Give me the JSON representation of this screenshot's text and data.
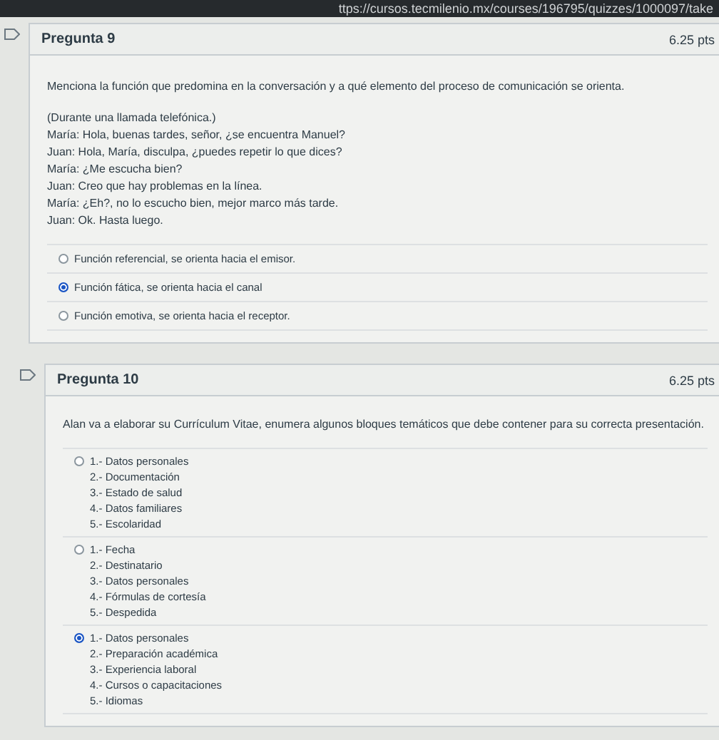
{
  "address_bar": {
    "url": "ttps://cursos.tecmilenio.mx/courses/196795/quizzes/1000097/take"
  },
  "questions": [
    {
      "title": "Pregunta 9",
      "points": "6.25 pts",
      "prompt": [
        "Menciona la función que predomina en la conversación y a qué elemento del proceso de comunicación se orienta.",
        "(Durante una llamada telefónica.)",
        "María: Hola, buenas tardes, señor, ¿se encuentra Manuel?",
        "Juan: Hola, María, disculpa, ¿puedes repetir lo que dices?",
        "María: ¿Me escucha bien?",
        "Juan: Creo que hay problemas en la línea.",
        "María: ¿Eh?, no lo escucho bien, mejor marco más tarde.",
        "Juan: Ok. Hasta luego."
      ],
      "answers": [
        {
          "lines": [
            "Función referencial, se orienta hacia el emisor."
          ],
          "selected": false
        },
        {
          "lines": [
            "Función fática, se orienta hacia el canal"
          ],
          "selected": true
        },
        {
          "lines": [
            "Función emotiva, se orienta hacia el receptor."
          ],
          "selected": false
        }
      ]
    },
    {
      "title": "Pregunta 10",
      "points": "6.25 pts",
      "prompt": [
        "Alan va a elaborar su Currículum Vitae, enumera algunos bloques temáticos que debe contener para su correcta presentación."
      ],
      "answers": [
        {
          "lines": [
            "1.- Datos personales",
            "2.- Documentación",
            "3.- Estado de salud",
            "4.- Datos familiares",
            "5.- Escolaridad"
          ],
          "selected": false
        },
        {
          "lines": [
            "1.- Fecha",
            "2.- Destinatario",
            "3.- Datos personales",
            "4.- Fórmulas de cortesía",
            "5.- Despedida"
          ],
          "selected": false
        },
        {
          "lines": [
            "1.- Datos personales",
            "2.- Preparación académica",
            "3.- Experiencia laboral",
            "4.- Cursos o capacitaciones",
            "5.- Idiomas"
          ],
          "selected": true
        }
      ]
    }
  ]
}
